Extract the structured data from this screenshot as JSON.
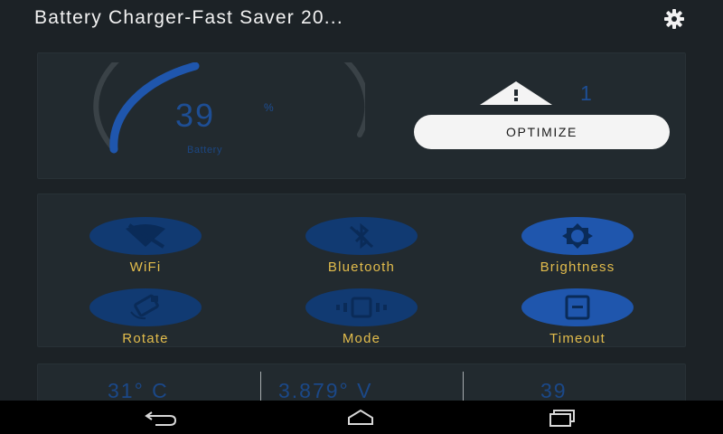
{
  "app": {
    "title": "Battery Charger-Fast Saver 20..."
  },
  "icons": {
    "settings": "gear-icon",
    "warning": "warning-triangle-icon",
    "wifi": "wifi-off-icon",
    "bluetooth": "bluetooth-off-icon",
    "brightness": "brightness-icon",
    "rotate": "rotate-icon",
    "mode": "vibrate-mode-icon",
    "timeout": "screen-timeout-icon",
    "nav_back": "back-icon",
    "nav_home": "home-icon",
    "nav_recent": "recent-apps-icon"
  },
  "battery": {
    "level": "39",
    "level_fraction": 0.39,
    "unit": "%",
    "label": "Battery"
  },
  "alerts": {
    "count": "1"
  },
  "optimize": {
    "label": "OPTIMIZE"
  },
  "toggles": [
    {
      "label": "WiFi",
      "on": false
    },
    {
      "label": "Bluetooth",
      "on": false
    },
    {
      "label": "Brightness",
      "on": true
    },
    {
      "label": "Rotate",
      "on": false
    },
    {
      "label": "Mode",
      "on": false
    },
    {
      "label": "Timeout",
      "on": true
    }
  ],
  "stats": {
    "temperature": "31° C",
    "voltage": "3.879° V",
    "health": "39"
  },
  "colors": {
    "background": "#1c2226",
    "accent_blue": "#1f56ad",
    "label_yellow": "#e2bc4c",
    "button_white": "#f4f4f4"
  }
}
